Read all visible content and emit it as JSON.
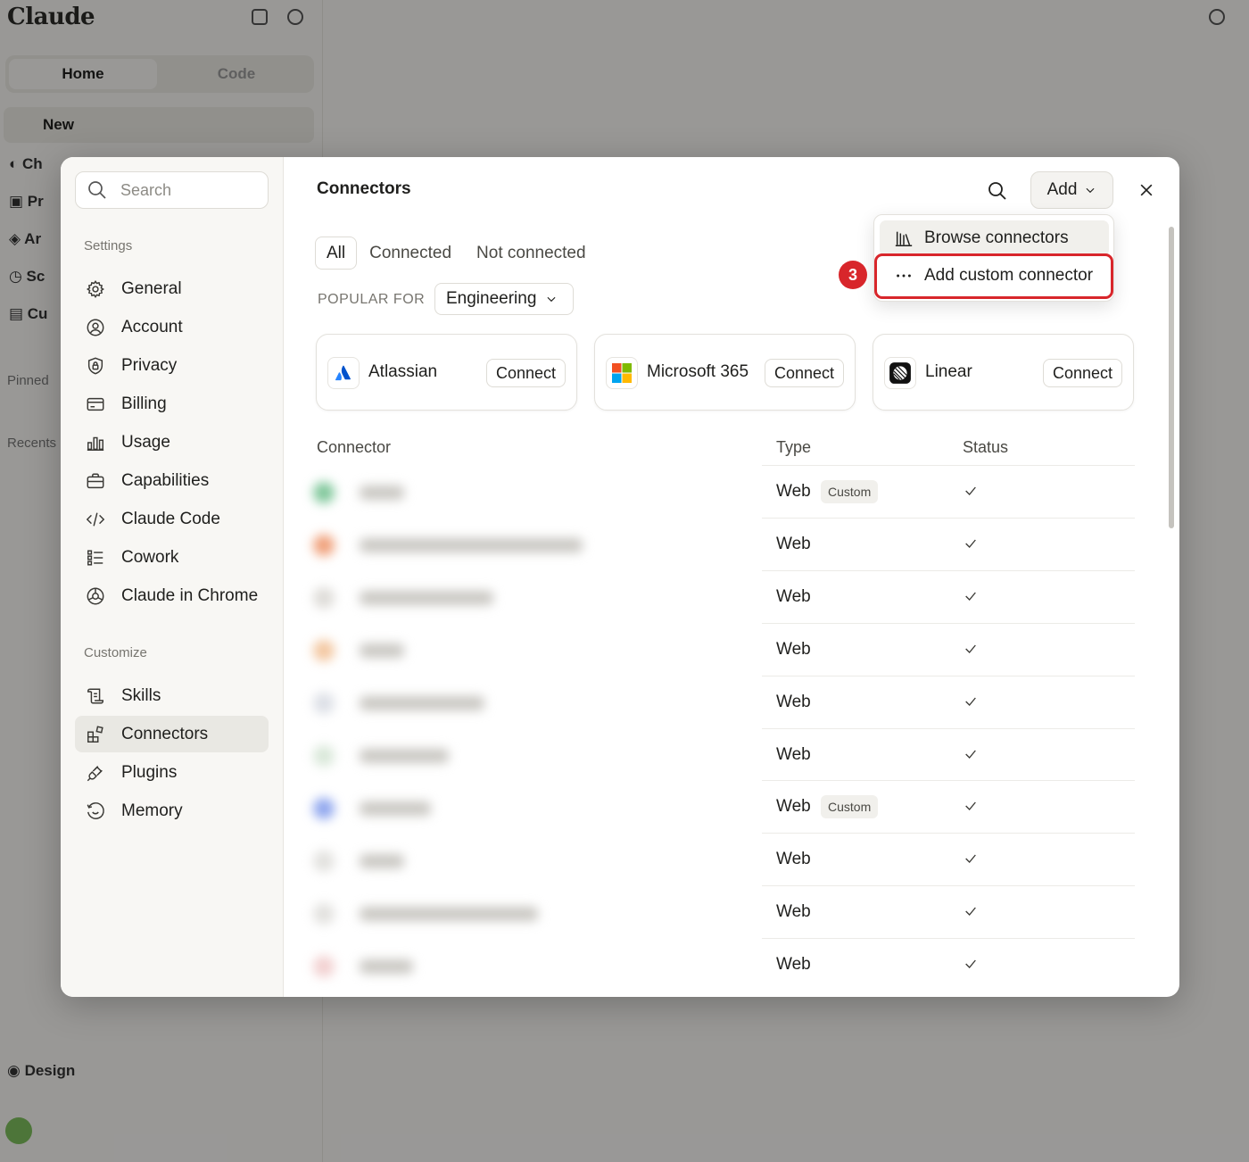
{
  "background": {
    "logo": "Claude",
    "tabs": [
      "Home",
      "Code"
    ],
    "new_label": "New",
    "footer_label": "Design"
  },
  "sidebar": {
    "search_placeholder": "Search",
    "settings_label": "Settings",
    "settings_items": [
      {
        "label": "General",
        "icon": "gear-icon"
      },
      {
        "label": "Account",
        "icon": "user-circle-icon"
      },
      {
        "label": "Privacy",
        "icon": "shield-lock-icon"
      },
      {
        "label": "Billing",
        "icon": "credit-card-icon"
      },
      {
        "label": "Usage",
        "icon": "bar-chart-icon"
      },
      {
        "label": "Capabilities",
        "icon": "briefcase-icon"
      },
      {
        "label": "Claude Code",
        "icon": "code-icon"
      },
      {
        "label": "Cowork",
        "icon": "checklist-icon"
      },
      {
        "label": "Claude in Chrome",
        "icon": "globe-icon"
      }
    ],
    "customize_label": "Customize",
    "customize_items": [
      {
        "label": "Skills",
        "icon": "scroll-icon"
      },
      {
        "label": "Connectors",
        "icon": "connectors-icon",
        "active": true
      },
      {
        "label": "Plugins",
        "icon": "plug-icon"
      },
      {
        "label": "Memory",
        "icon": "memory-icon"
      }
    ]
  },
  "main": {
    "title": "Connectors",
    "add_label": "Add",
    "filter_tabs": [
      "All",
      "Connected",
      "Not connected"
    ],
    "active_filter": "All",
    "popular_for_label": "POPULAR FOR",
    "popular_for_value": "Engineering",
    "cards": [
      {
        "name": "Atlassian",
        "button": "Connect"
      },
      {
        "name": "Microsoft 365",
        "button": "Connect"
      },
      {
        "name": "Linear",
        "button": "Connect"
      }
    ],
    "table": {
      "headers": [
        "Connector",
        "Type",
        "Status"
      ],
      "rows": [
        {
          "type": "Web",
          "badge": "Custom",
          "status": "connected"
        },
        {
          "type": "Web",
          "badge": "",
          "status": "connected"
        },
        {
          "type": "Web",
          "badge": "",
          "status": "connected"
        },
        {
          "type": "Web",
          "badge": "",
          "status": "connected"
        },
        {
          "type": "Web",
          "badge": "",
          "status": "connected"
        },
        {
          "type": "Web",
          "badge": "",
          "status": "connected"
        },
        {
          "type": "Web",
          "badge": "Custom",
          "status": "connected"
        },
        {
          "type": "Web",
          "badge": "",
          "status": "connected"
        },
        {
          "type": "Web",
          "badge": "",
          "status": "connected"
        },
        {
          "type": "Web",
          "badge": "",
          "status": "connected"
        }
      ]
    }
  },
  "dropdown": {
    "items": [
      {
        "label": "Browse connectors",
        "icon": "library-icon"
      },
      {
        "label": "Add custom connector",
        "icon": "more-horizontal-icon"
      }
    ],
    "step_number": "3"
  },
  "colors": {
    "highlight": "#d8262b",
    "active_nav": "#e9e8e3"
  }
}
